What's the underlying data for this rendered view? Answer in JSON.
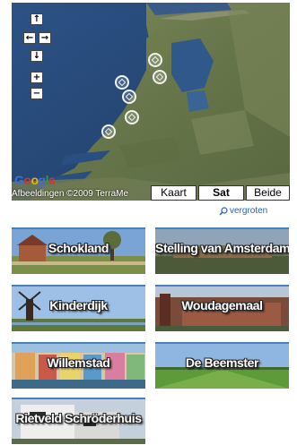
{
  "map": {
    "zoom_in": "+",
    "zoom_out": "−",
    "pan_up": "↑",
    "pan_down": "↓",
    "pan_left": "←",
    "pan_right": "→",
    "logo_text": "Google",
    "copyright": "Afbeeldingen ©2009 TerraMe",
    "type_buttons": [
      {
        "label": "Kaart",
        "active": false
      },
      {
        "label": "Sat",
        "active": true
      },
      {
        "label": "Beide",
        "active": false
      }
    ],
    "enlarge_label": "vergroten",
    "colors": {
      "water": "#2a4b78",
      "land": "#6b7a4a",
      "link": "#1a66c4"
    }
  },
  "tiles": [
    {
      "label": "Schokland"
    },
    {
      "label": "Stelling van Amsterdam"
    },
    {
      "label": "Kinderdijk"
    },
    {
      "label": "Woudagemaal"
    },
    {
      "label": "Willemstad"
    },
    {
      "label": "De Beemster"
    },
    {
      "label": "Rietveld Schröderhuis"
    }
  ]
}
